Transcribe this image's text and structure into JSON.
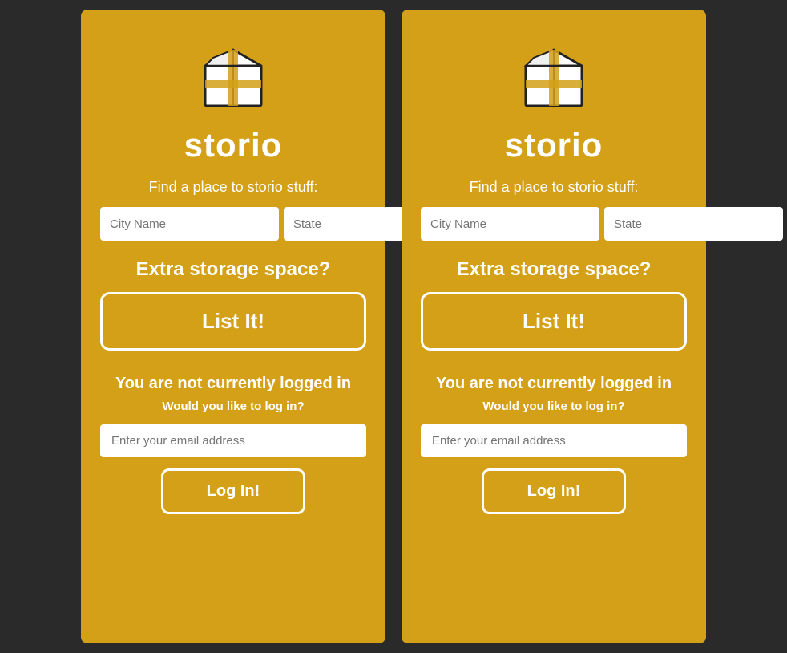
{
  "app": {
    "title": "storio",
    "find_text": "Find a place to storio stuff:",
    "city_placeholder": "City Name",
    "state_placeholder": "State",
    "extra_storage_text": "Extra storage space?",
    "list_it_label": "List It!",
    "not_logged_text": "You are not currently logged in",
    "would_you_text": "Would you like to log in?",
    "email_placeholder": "Enter your email address",
    "login_label": "Log In!",
    "accent_color": "#d4a017"
  }
}
